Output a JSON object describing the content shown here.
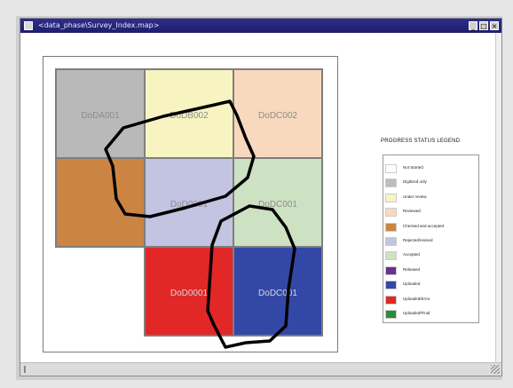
{
  "window": {
    "title": "<data_phase\\Survey_Index.map>",
    "min_label": "_",
    "max_label": "□",
    "close_label": "×"
  },
  "map": {
    "cells": [
      {
        "label": "DoDA001",
        "color": "#b9b9b9"
      },
      {
        "label": "DoDB002",
        "color": "#f7f4c1"
      },
      {
        "label": "DoDC002",
        "color": "#f8d9bd"
      },
      {
        "label": "",
        "color": "#cc8442"
      },
      {
        "label": "DoD0001",
        "color": "#c3c3e2"
      },
      {
        "label": "DoDC001",
        "color": "#cde2c3"
      },
      {
        "label": "DoD0001",
        "color": "#e22727"
      },
      {
        "label": "DoDC001",
        "color": "#3348a6"
      }
    ]
  },
  "legend": {
    "title": "PROGRESS STATUS LEGEND",
    "items": [
      {
        "label": "Not Started",
        "color": "#ffffff"
      },
      {
        "label": "Digitized only",
        "color": "#bdbdbd"
      },
      {
        "label": "Under review",
        "color": "#f7f4c1"
      },
      {
        "label": "Reviewed",
        "color": "#f8d9bd"
      },
      {
        "label": "Checked and accepted",
        "color": "#cc8442"
      },
      {
        "label": "Rejected/revised",
        "color": "#c3c3e2"
      },
      {
        "label": "Accepted",
        "color": "#cde2c3"
      },
      {
        "label": "Released",
        "color": "#6b2e8f"
      },
      {
        "label": "Uploaded",
        "color": "#3348a6"
      },
      {
        "label": "Uploaded/Error",
        "color": "#e22727"
      },
      {
        "label": "Uploaded/Final",
        "color": "#2e8a3a"
      }
    ]
  }
}
